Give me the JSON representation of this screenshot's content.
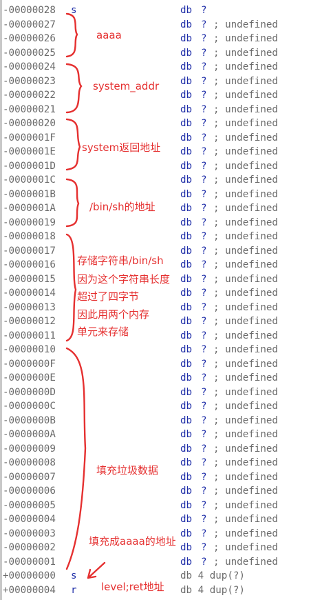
{
  "rows": [
    {
      "offset": "-00000028",
      "name": "s",
      "directive": "db",
      "operand": "?",
      "comment": ""
    },
    {
      "offset": "-00000027",
      "name": "",
      "directive": "db",
      "operand": "?",
      "comment": "; undefined"
    },
    {
      "offset": "-00000026",
      "name": "",
      "directive": "db",
      "operand": "?",
      "comment": "; undefined"
    },
    {
      "offset": "-00000025",
      "name": "",
      "directive": "db",
      "operand": "?",
      "comment": "; undefined"
    },
    {
      "offset": "-00000024",
      "name": "",
      "directive": "db",
      "operand": "?",
      "comment": "; undefined"
    },
    {
      "offset": "-00000023",
      "name": "",
      "directive": "db",
      "operand": "?",
      "comment": "; undefined"
    },
    {
      "offset": "-00000022",
      "name": "",
      "directive": "db",
      "operand": "?",
      "comment": "; undefined"
    },
    {
      "offset": "-00000021",
      "name": "",
      "directive": "db",
      "operand": "?",
      "comment": "; undefined"
    },
    {
      "offset": "-00000020",
      "name": "",
      "directive": "db",
      "operand": "?",
      "comment": "; undefined"
    },
    {
      "offset": "-0000001F",
      "name": "",
      "directive": "db",
      "operand": "?",
      "comment": "; undefined"
    },
    {
      "offset": "-0000001E",
      "name": "",
      "directive": "db",
      "operand": "?",
      "comment": "; undefined"
    },
    {
      "offset": "-0000001D",
      "name": "",
      "directive": "db",
      "operand": "?",
      "comment": "; undefined"
    },
    {
      "offset": "-0000001C",
      "name": "",
      "directive": "db",
      "operand": "?",
      "comment": "; undefined"
    },
    {
      "offset": "-0000001B",
      "name": "",
      "directive": "db",
      "operand": "?",
      "comment": "; undefined"
    },
    {
      "offset": "-0000001A",
      "name": "",
      "directive": "db",
      "operand": "?",
      "comment": "; undefined"
    },
    {
      "offset": "-00000019",
      "name": "",
      "directive": "db",
      "operand": "?",
      "comment": "; undefined"
    },
    {
      "offset": "-00000018",
      "name": "",
      "directive": "db",
      "operand": "?",
      "comment": "; undefined"
    },
    {
      "offset": "-00000017",
      "name": "",
      "directive": "db",
      "operand": "?",
      "comment": "; undefined"
    },
    {
      "offset": "-00000016",
      "name": "",
      "directive": "db",
      "operand": "?",
      "comment": "; undefined"
    },
    {
      "offset": "-00000015",
      "name": "",
      "directive": "db",
      "operand": "?",
      "comment": "; undefined"
    },
    {
      "offset": "-00000014",
      "name": "",
      "directive": "db",
      "operand": "?",
      "comment": "; undefined"
    },
    {
      "offset": "-00000013",
      "name": "",
      "directive": "db",
      "operand": "?",
      "comment": "; undefined"
    },
    {
      "offset": "-00000012",
      "name": "",
      "directive": "db",
      "operand": "?",
      "comment": "; undefined"
    },
    {
      "offset": "-00000011",
      "name": "",
      "directive": "db",
      "operand": "?",
      "comment": "; undefined"
    },
    {
      "offset": "-00000010",
      "name": "",
      "directive": "db",
      "operand": "?",
      "comment": "; undefined"
    },
    {
      "offset": "-0000000F",
      "name": "",
      "directive": "db",
      "operand": "?",
      "comment": "; undefined"
    },
    {
      "offset": "-0000000E",
      "name": "",
      "directive": "db",
      "operand": "?",
      "comment": "; undefined"
    },
    {
      "offset": "-0000000D",
      "name": "",
      "directive": "db",
      "operand": "?",
      "comment": "; undefined"
    },
    {
      "offset": "-0000000C",
      "name": "",
      "directive": "db",
      "operand": "?",
      "comment": "; undefined"
    },
    {
      "offset": "-0000000B",
      "name": "",
      "directive": "db",
      "operand": "?",
      "comment": "; undefined"
    },
    {
      "offset": "-0000000A",
      "name": "",
      "directive": "db",
      "operand": "?",
      "comment": "; undefined"
    },
    {
      "offset": "-00000009",
      "name": "",
      "directive": "db",
      "operand": "?",
      "comment": "; undefined"
    },
    {
      "offset": "-00000008",
      "name": "",
      "directive": "db",
      "operand": "?",
      "comment": "; undefined"
    },
    {
      "offset": "-00000007",
      "name": "",
      "directive": "db",
      "operand": "?",
      "comment": "; undefined"
    },
    {
      "offset": "-00000006",
      "name": "",
      "directive": "db",
      "operand": "?",
      "comment": "; undefined"
    },
    {
      "offset": "-00000005",
      "name": "",
      "directive": "db",
      "operand": "?",
      "comment": "; undefined"
    },
    {
      "offset": "-00000004",
      "name": "",
      "directive": "db",
      "operand": "?",
      "comment": "; undefined"
    },
    {
      "offset": "-00000003",
      "name": "",
      "directive": "db",
      "operand": "?",
      "comment": "; undefined"
    },
    {
      "offset": "-00000002",
      "name": "",
      "directive": "db",
      "operand": "?",
      "comment": "; undefined"
    },
    {
      "offset": "-00000001",
      "name": "",
      "directive": "db",
      "operand": "?",
      "comment": "; undefined"
    },
    {
      "offset": "+00000000",
      "name": "s",
      "directive": "db 4 dup(?)",
      "operand": "",
      "comment": ""
    },
    {
      "offset": "+00000004",
      "name": "r",
      "directive": "db 4 dup(?)",
      "operand": "",
      "comment": ""
    }
  ],
  "annotations": {
    "aaaa": "aaaa",
    "system_addr": "system_addr",
    "system_ret": "system返回地址",
    "binsh_addr": "/bin/sh的地址",
    "store_lines": [
      "存储字符串/bin/sh",
      "因为这个字符串长度",
      "超过了四字节",
      "因此用两个内存",
      "单元来存储"
    ],
    "padding": "填充垃圾数据",
    "fill_aaaa": "填充成aaaa的地址",
    "level_ret": "level;ret地址"
  },
  "colors": {
    "annotation": "#e53030",
    "offset": "#6b6b6b",
    "keyword": "#1f2ea8"
  }
}
